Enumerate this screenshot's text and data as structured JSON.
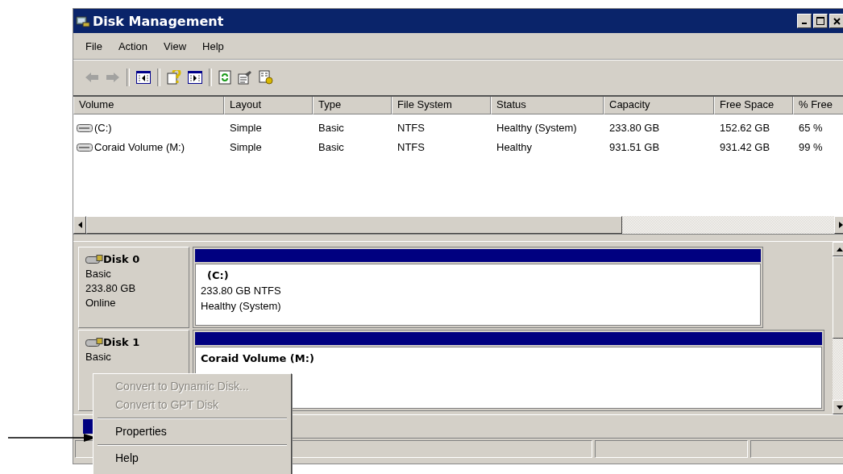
{
  "window": {
    "title": "Disk Management"
  },
  "menu": [
    "File",
    "Action",
    "View",
    "Help"
  ],
  "toolbar": [
    {
      "kind": "back",
      "disabled": true
    },
    {
      "kind": "forward",
      "disabled": true
    },
    {
      "kind": "sep"
    },
    {
      "kind": "tree"
    },
    {
      "kind": "sep"
    },
    {
      "kind": "help"
    },
    {
      "kind": "pane"
    },
    {
      "kind": "sep"
    },
    {
      "kind": "refresh"
    },
    {
      "kind": "properties"
    },
    {
      "kind": "settings"
    }
  ],
  "table": {
    "columns": [
      "Volume",
      "Layout",
      "Type",
      "File System",
      "Status",
      "Capacity",
      "Free Space",
      "% Free"
    ],
    "rows": [
      [
        "(C:)",
        "Simple",
        "Basic",
        "NTFS",
        "Healthy (System)",
        "233.80 GB",
        "152.62 GB",
        "65 %"
      ],
      [
        "Coraid Volume (M:)",
        "Simple",
        "Basic",
        "NTFS",
        "Healthy",
        "931.51 GB",
        "931.42 GB",
        "99 %"
      ]
    ]
  },
  "disks": [
    {
      "name": "Disk 0",
      "lines": [
        "Basic",
        "233.80 GB",
        "Online"
      ],
      "partition": {
        "name": "(C:)",
        "lines": [
          "233.80 GB NTFS",
          "Healthy (System)"
        ]
      }
    },
    {
      "name": "Disk 1",
      "lines": [
        "Basic"
      ],
      "partition": {
        "name": "Coraid Volume  (M:)"
      }
    }
  ],
  "context_menu": [
    {
      "kind": "item",
      "label": "Convert to Dynamic Disk...",
      "disabled": true
    },
    {
      "kind": "item",
      "label": "Convert to GPT Disk",
      "disabled": true
    },
    {
      "kind": "separator"
    },
    {
      "kind": "item",
      "label": "Properties",
      "disabled": false
    },
    {
      "kind": "separator"
    },
    {
      "kind": "item",
      "label": "Help",
      "disabled": false
    }
  ]
}
